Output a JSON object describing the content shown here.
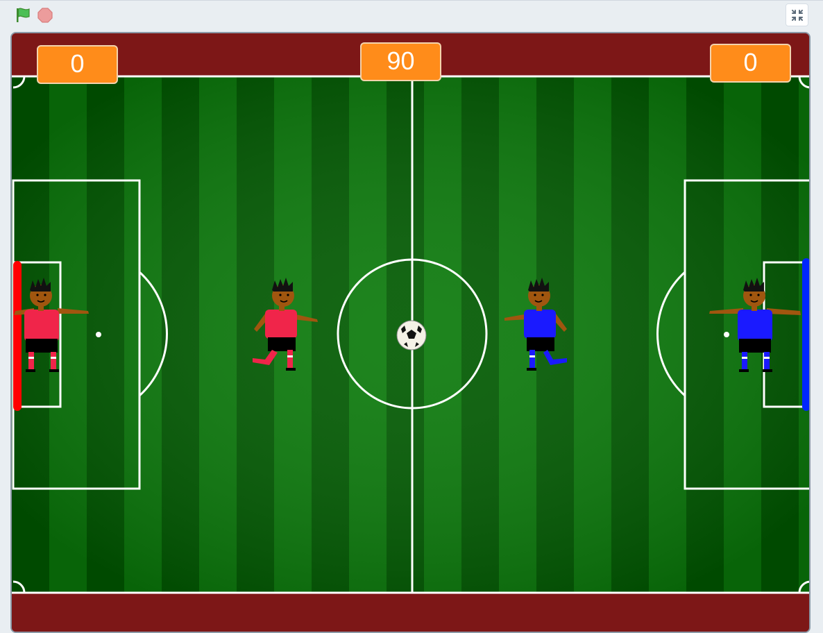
{
  "toolbar": {
    "green_flag": "green-flag-icon",
    "stop": "stop-sign-icon",
    "fullscreen": "exit-fullscreen-icon"
  },
  "monitors": {
    "left_score": "0",
    "timer": "90",
    "right_score": "0"
  },
  "colors": {
    "stage_border": "#7d1717",
    "pitch_dark": "#005a00",
    "pitch_light": "#0a7a0a",
    "monitor": "#ff8c1a",
    "red_team": "#f0254a",
    "blue_team": "#1a1aff",
    "red_goal": "#ff0000",
    "blue_goal": "#0026ff"
  },
  "sprites": [
    "red-goalkeeper",
    "red-player",
    "soccer-ball",
    "blue-player",
    "blue-goalkeeper"
  ]
}
